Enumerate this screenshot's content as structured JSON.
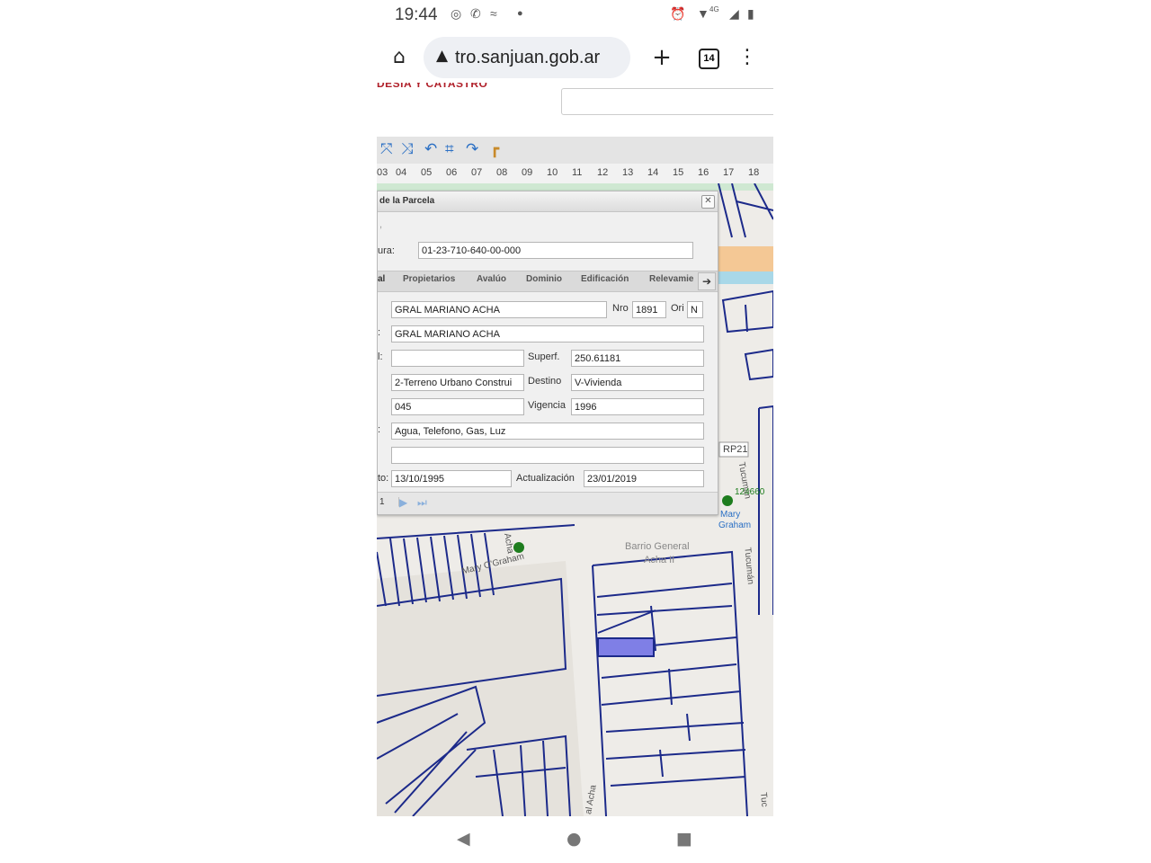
{
  "status_bar": {
    "time": "19:44",
    "network": "4G"
  },
  "browser": {
    "url": "tro.sanjuan.gob.ar",
    "tab_count": "14"
  },
  "site": {
    "brand": "DESIA Y CATASTRO"
  },
  "ruler": {
    "ticks": [
      "03",
      "04",
      "05",
      "06",
      "07",
      "08",
      "09",
      "10",
      "11",
      "12",
      "13",
      "14",
      "15",
      "16",
      "17",
      "18"
    ]
  },
  "dialog": {
    "title": "de la Parcela",
    "nomenclatura_label": "ura:",
    "nomenclatura_value": "01-23-710-640-00-000",
    "tabs": [
      "al",
      "Propietarios",
      "Avalúo",
      "Dominio",
      "Edificación",
      "Relevamie"
    ],
    "calle_label": "",
    "calle_value": "GRAL MARIANO ACHA",
    "nro_label": "Nro",
    "nro_value": "1891",
    "ori_label": "Ori",
    "ori_value": "N",
    "calle2_label": ":",
    "calle2_value": "GRAL MARIANO ACHA",
    "field3_label": "l:",
    "field3_value": "",
    "superf_label": "Superf.",
    "superf_value": "250.61181",
    "tipo_value": "2-Terreno Urbano Construi",
    "destino_label": "Destino",
    "destino_value": "V-Vivienda",
    "zona_value": "045",
    "vigencia_label": "Vigencia",
    "vigencia_value": "1996",
    "servicios_label": ":",
    "servicios_value": "Agua, Telefono, Gas, Luz",
    "obs_value": "",
    "fecha_label": "to:",
    "fecha_value": "13/10/1995",
    "actualizacion_label": "Actualización",
    "actualizacion_value": "23/01/2019",
    "pager_text": "1"
  },
  "map": {
    "labels": {
      "street_mary": "Mary O'Graham",
      "street_acha": "Acha",
      "barrio": "Barrio General",
      "barrio2": "Acha II",
      "tucuman1": "Tucumán",
      "tucuman2": "Tucumán",
      "rp21": "RP21",
      "poi_mary": "Mary",
      "poi_graham": "Graham",
      "poi_code": "124660",
      "gral_acha": "al Acha",
      "tuc_edge": "Tuc"
    }
  },
  "colors": {
    "parcel_line": "#1c2a8a",
    "highlight": "#7f7fe6",
    "point": "#1e7d1e",
    "brand_red": "#b0202a"
  }
}
